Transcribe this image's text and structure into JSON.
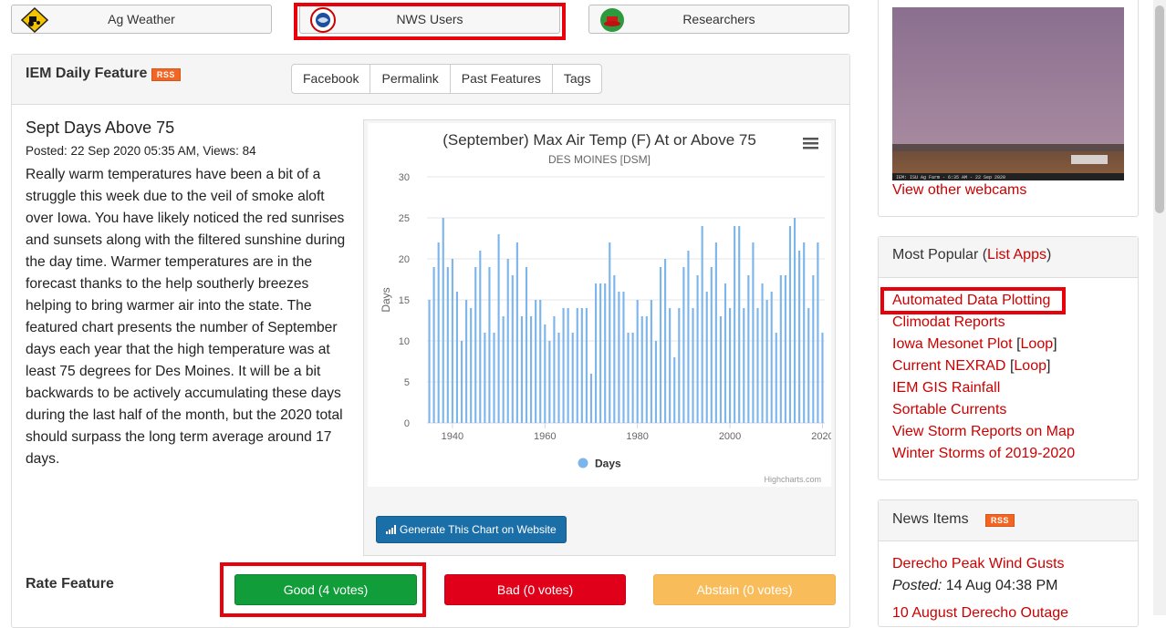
{
  "users": {
    "ag": "Ag Weather",
    "nws": "NWS Users",
    "researchers": "Researchers"
  },
  "feature": {
    "header": "IEM Daily Feature",
    "rss": "RSS",
    "tabs": [
      "Facebook",
      "Permalink",
      "Past Features",
      "Tags"
    ],
    "title": "Sept Days Above 75",
    "meta": "Posted: 22 Sep 2020 05:35 AM, Views: 84",
    "body": "Really warm temperatures have been a bit of a struggle this week due to the veil of smoke aloft over Iowa. You have likely noticed the red sunrises and sunsets along with the filtered sunshine during the day time. Warmer temperatures are in the forecast thanks to the help southerly breezes helping to bring warmer air into the state. The featured chart presents the number of September days each year that the high temperature was at least 75 degrees for Des Moines. It will be a bit backwards to be actively accumulating these days during the last half of the month, but the 2020 total should surpass the long term average around 17 days.",
    "generate_button": "Generate This Chart on Website",
    "rate_label": "Rate Feature",
    "good": "Good (4 votes)",
    "bad": "Bad (0 votes)",
    "abstain": "Abstain (0 votes)"
  },
  "chart_data": {
    "type": "bar",
    "title": "(September) Max Air Temp (F) At or Above 75",
    "subtitle": "DES MOINES [DSM]",
    "ylabel": "Days",
    "xlabel": "",
    "ylim": [
      0,
      30
    ],
    "yticks": [
      0,
      5,
      10,
      15,
      20,
      25,
      30
    ],
    "xticks": [
      1940,
      1960,
      1980,
      2000,
      2020
    ],
    "legend": "Days",
    "legend_position": "bottom",
    "credits": "Highcharts.com",
    "series_color": "#7cb5ec",
    "x": [
      1935,
      1936,
      1937,
      1938,
      1939,
      1940,
      1941,
      1942,
      1943,
      1944,
      1945,
      1946,
      1947,
      1948,
      1949,
      1950,
      1951,
      1952,
      1953,
      1954,
      1955,
      1956,
      1957,
      1958,
      1959,
      1960,
      1961,
      1962,
      1963,
      1964,
      1965,
      1966,
      1967,
      1968,
      1969,
      1970,
      1971,
      1972,
      1973,
      1974,
      1975,
      1976,
      1977,
      1978,
      1979,
      1980,
      1981,
      1982,
      1983,
      1984,
      1985,
      1986,
      1987,
      1988,
      1989,
      1990,
      1991,
      1992,
      1993,
      1994,
      1995,
      1996,
      1997,
      1998,
      1999,
      2000,
      2001,
      2002,
      2003,
      2004,
      2005,
      2006,
      2007,
      2008,
      2009,
      2010,
      2011,
      2012,
      2013,
      2014,
      2015,
      2016,
      2017,
      2018,
      2019,
      2020
    ],
    "values": [
      15,
      19,
      22,
      25,
      19,
      20,
      16,
      10,
      15,
      14,
      19,
      21,
      11,
      19,
      11,
      23,
      13,
      20,
      18,
      22,
      13,
      19,
      13,
      15,
      15,
      12,
      10,
      13,
      11,
      14,
      14,
      11,
      14,
      14,
      14,
      6,
      17,
      17,
      17,
      22,
      18,
      16,
      16,
      11,
      11,
      15,
      13,
      13,
      15,
      10,
      19,
      20,
      14,
      8,
      14,
      19,
      21,
      14,
      18,
      24,
      16,
      19,
      22,
      13,
      17,
      14,
      24,
      24,
      14,
      18,
      22,
      14,
      17,
      15,
      16,
      11,
      18,
      18,
      24,
      25,
      21,
      22,
      14,
      18,
      22,
      11
    ]
  },
  "webcam": {
    "caption": "IEM: ISU Ag Farm - 6:35 AM - 22 Sep 2020",
    "link": "View other webcams"
  },
  "popular": {
    "label": "Most Popular (",
    "list_apps": "List Apps",
    "close": ")",
    "items": [
      {
        "text": "Automated Data Plotting"
      },
      {
        "text": "Climodat Reports"
      },
      {
        "text": "Iowa Mesonet Plot",
        "extra": "Loop"
      },
      {
        "text": "Current NEXRAD",
        "extra": "Loop"
      },
      {
        "text": "IEM GIS Rainfall"
      },
      {
        "text": "Sortable Currents"
      },
      {
        "text": "View Storm Reports on Map"
      },
      {
        "text": "Winter Storms of 2019-2020"
      }
    ]
  },
  "news": {
    "label": "News Items",
    "rss": "RSS",
    "item1_title": "Derecho Peak Wind Gusts",
    "item1_posted_label": "Posted:",
    "item1_posted": " 14 Aug 04:38 PM",
    "item2_title": "10 August Derecho Outage"
  },
  "colors": {
    "highlight": "#e8000b",
    "good": "#109d3a",
    "bad": "#e00019",
    "abstain": "#f8bd5a",
    "link": "#cc0000",
    "primary": "#1b6fa8"
  }
}
